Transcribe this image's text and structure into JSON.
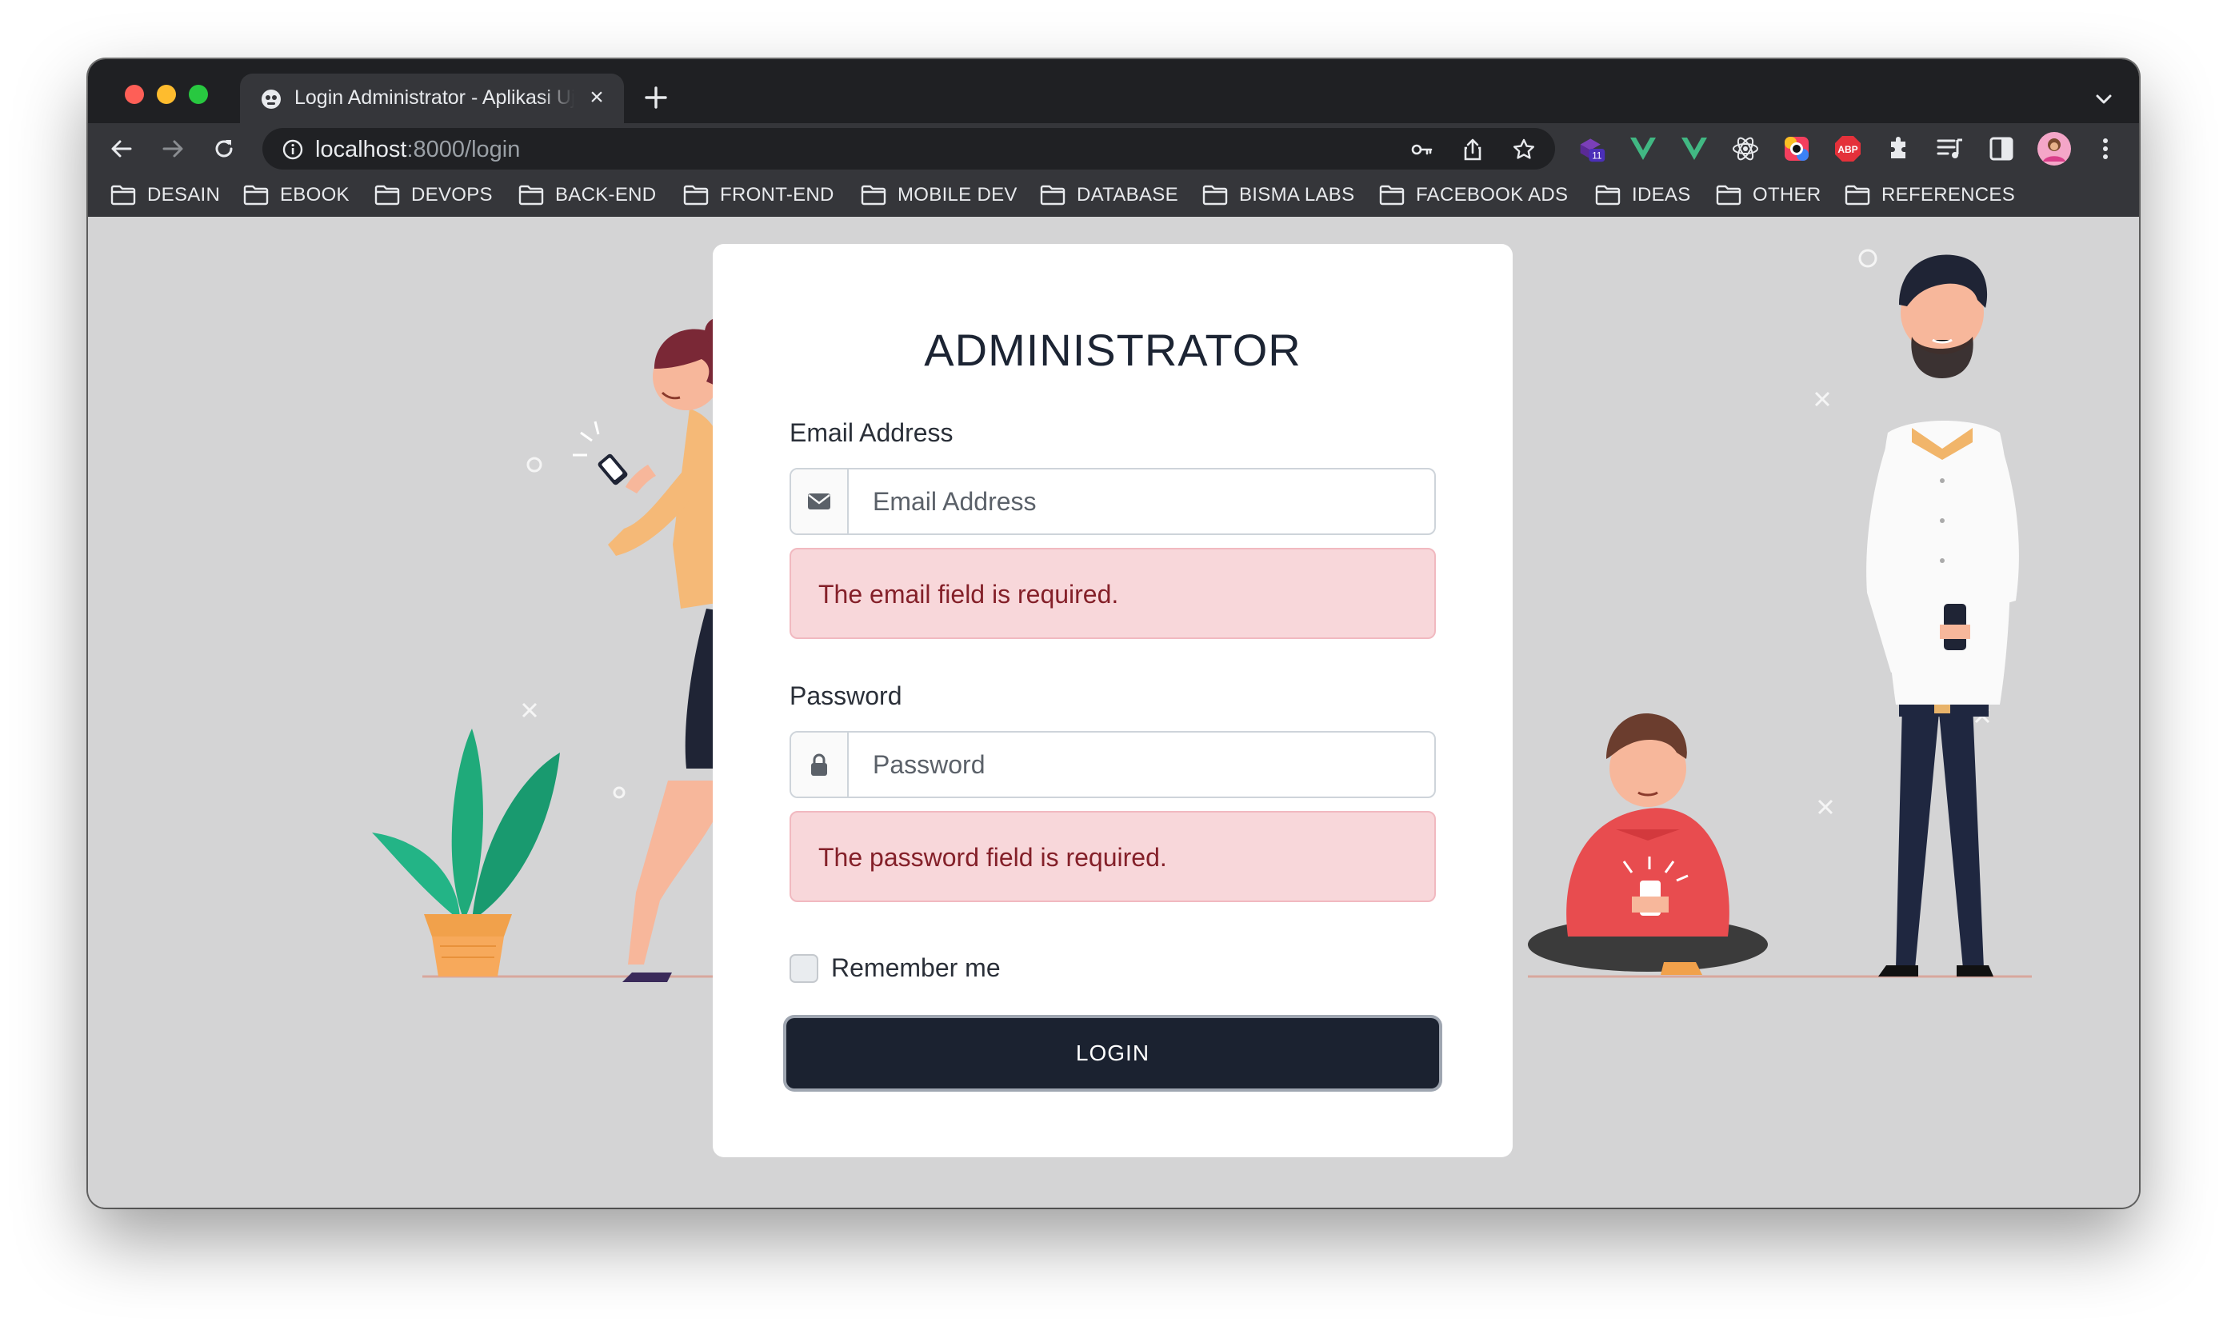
{
  "browser": {
    "tab_title": "Login Administrator - Aplikasi Ujian",
    "url_host": "localhost",
    "url_path": ":8000/login",
    "extension_badge": "11",
    "abp_label": "ABP"
  },
  "bookmarks": [
    "DESAIN",
    "EBOOK",
    "DEVOPS",
    "BACK-END",
    "FRONT-END",
    "MOBILE DEV",
    "DATABASE",
    "BISMA LABS",
    "FACEBOOK ADS",
    "IDEAS",
    "OTHER",
    "REFERENCES"
  ],
  "login": {
    "title": "ADMINISTRATOR",
    "email_label": "Email Address",
    "email_placeholder": "Email Address",
    "email_error": "The email field is required.",
    "password_label": "Password",
    "password_placeholder": "Password",
    "password_error": "The password field is required.",
    "remember_label": "Remember me",
    "submit_label": "LOGIN"
  },
  "icons": {
    "email_addon": "envelope-icon",
    "password_addon": "lock-icon"
  },
  "colors": {
    "page_bg": "#d4d4d5",
    "button_bg": "#1b2230",
    "alert_bg": "#f8d7da",
    "alert_text": "#842029"
  }
}
